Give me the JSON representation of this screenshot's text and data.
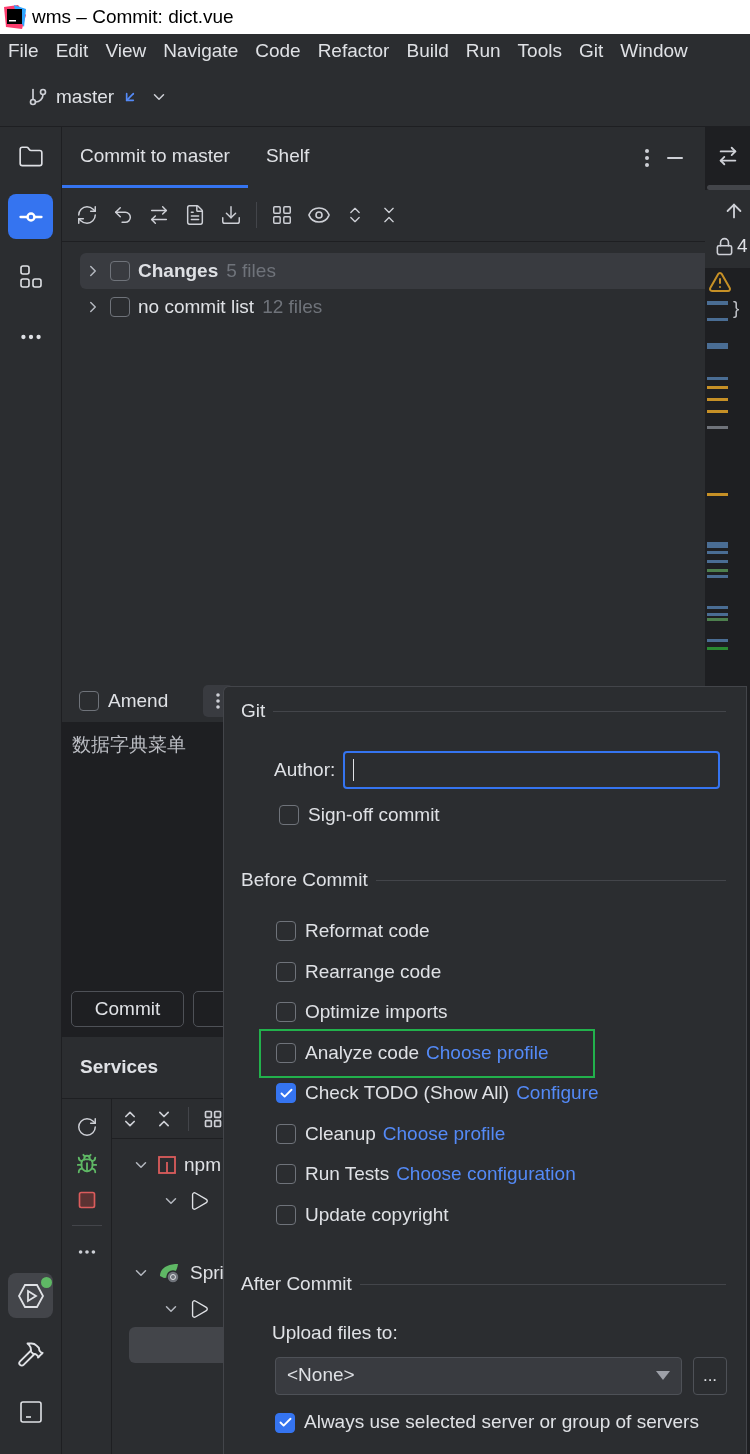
{
  "window": {
    "title": "wms – Commit: dict.vue"
  },
  "menu": [
    "File",
    "Edit",
    "View",
    "Navigate",
    "Code",
    "Refactor",
    "Build",
    "Run",
    "Tools",
    "Git",
    "Window"
  ],
  "branch": {
    "name": "master"
  },
  "tool_strip_top": [
    {
      "kind": "project",
      "selected": false
    },
    {
      "kind": "commit",
      "selected": true
    },
    {
      "kind": "structure",
      "selected": false
    },
    {
      "kind": "more",
      "selected": false
    }
  ],
  "tool_strip_bottom": [
    {
      "kind": "services",
      "selected": true
    },
    {
      "kind": "build",
      "selected": false
    },
    {
      "kind": "terminal",
      "selected": false
    }
  ],
  "commit_panel": {
    "tabs": [
      {
        "label": "Commit to master",
        "selected": true
      },
      {
        "label": "Shelf",
        "selected": false
      }
    ],
    "changes": [
      {
        "name": "Changes",
        "count": "5 files",
        "checked": false,
        "expanded": false,
        "selected": true
      },
      {
        "name": "no commit list",
        "count": "12 files",
        "checked": false,
        "expanded": false,
        "selected": false
      }
    ],
    "amend": {
      "label": "Amend",
      "checked": false
    },
    "message": "数据字典菜单",
    "buttons": [
      "Commit"
    ]
  },
  "services": {
    "title": "Services",
    "tree": [
      {
        "kind": "npm",
        "label": "npm",
        "expanded": true,
        "children": [
          {
            "kind": "run",
            "expanded": true,
            "children": [
              {
                "kind": "process",
                "selected": false
              }
            ]
          }
        ]
      },
      {
        "kind": "spring",
        "label": "Spri",
        "expanded": true,
        "children": [
          {
            "kind": "run",
            "expanded": true,
            "children": [
              {
                "kind": "process",
                "selected": true
              }
            ]
          }
        ]
      }
    ]
  },
  "editor_gutter": {
    "line": "4",
    "brace": "}"
  },
  "popup": {
    "git": {
      "title": "Git",
      "author_label": "Author:",
      "sign_off": {
        "label": "Sign-off commit",
        "checked": false
      }
    },
    "before_commit": {
      "title": "Before Commit",
      "options": [
        {
          "label": "Reformat code",
          "checked": false,
          "highlighted": false
        },
        {
          "label": "Rearrange code",
          "checked": false,
          "highlighted": false
        },
        {
          "label": "Optimize imports",
          "checked": false,
          "highlighted": false
        },
        {
          "label": "Analyze code",
          "link": "Choose profile",
          "checked": false,
          "highlighted": true
        },
        {
          "label": "Check TODO (Show All)",
          "link": "Configure",
          "checked": true,
          "highlighted": false
        },
        {
          "label": "Cleanup",
          "link": "Choose profile",
          "checked": false,
          "highlighted": false
        },
        {
          "label": "Run Tests",
          "link": "Choose configuration",
          "checked": false,
          "highlighted": false
        },
        {
          "label": "Update copyright",
          "checked": false,
          "highlighted": false
        }
      ]
    },
    "after_commit": {
      "title": "After Commit",
      "upload_label": "Upload files to:",
      "server": "<None>",
      "browse": "...",
      "always_use": {
        "label": "Always use selected server or group of servers",
        "checked": true
      }
    }
  }
}
